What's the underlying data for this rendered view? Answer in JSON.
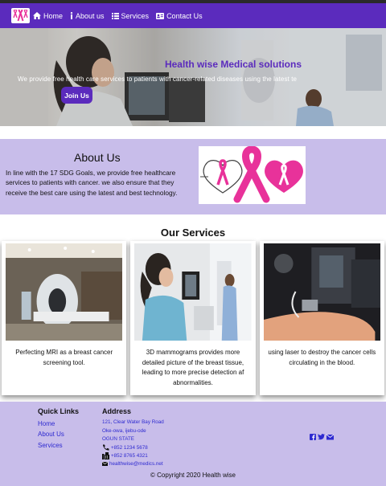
{
  "nav": {
    "items": [
      {
        "label": "Home",
        "icon": "home-icon"
      },
      {
        "label": "About us",
        "icon": "info-icon"
      },
      {
        "label": "Services",
        "icon": "list-icon"
      },
      {
        "label": "Contact Us",
        "icon": "contact-card-icon"
      }
    ]
  },
  "hero": {
    "title": "Health wise Medical solutions",
    "subtitle": "We provide free health care services to patients with cancer-related diseases using the latest te",
    "button": "Join Us"
  },
  "about": {
    "heading": "About Us",
    "body": "In line with the 17 SDG Goals, we provide free healthcare services to patients with cancer. we also ensure that they receive the best care using the latest and best technology."
  },
  "services": {
    "heading": "Our Services",
    "cards": [
      {
        "caption": "Perfecting MRI as a breast cancer screening tool."
      },
      {
        "caption": "3D mammograms provides more detailed picture of the breast tissue, leading to more precise detection af abnormalities."
      },
      {
        "caption": "using laser to destroy the cancer cells circulating in the blood."
      }
    ]
  },
  "footer": {
    "quick_links_heading": "Quick Links",
    "links": [
      "Home",
      "About Us",
      "Services"
    ],
    "address_heading": "Address",
    "address_lines": [
      "121, Clear Water Bay Road",
      "Oke-owa, ijebu-ode",
      "OGUN STATE"
    ],
    "phone": "+852 1234 5678",
    "fax": "+852 8765 4321",
    "email": "healthwise@medics.net",
    "copyright": "© Copyright 2020 Health wise"
  },
  "colors": {
    "brand_purple": "#5b2bbd",
    "lavender": "#c8bdea",
    "ribbon_pink": "#e8329a",
    "link_blue": "#2e2ad0"
  }
}
